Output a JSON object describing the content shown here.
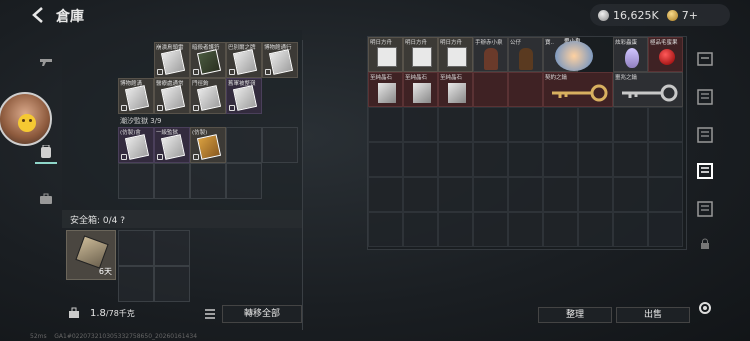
{
  "header": {
    "title": "倉庫",
    "silver": "16,625K",
    "gold": "7+"
  },
  "stash": {
    "row1": [
      "崩潰鳥頭雷",
      "暗殺者護符",
      "巴別爾之牌",
      "博物館通行"
    ],
    "row2": [
      "博物館溝",
      "醫療處通常",
      "門徑鉤",
      "舊軍被整嶺"
    ],
    "prison_label": "潮汐監獄 3/9",
    "row3": [
      "(仿製)會",
      "一級監獄",
      "(仿製)"
    ]
  },
  "safe_box": {
    "label": "安全箱: 0/4 ?",
    "days": "6天"
  },
  "weight": {
    "current": "1.8",
    "max": "/78千克"
  },
  "buttons": {
    "transfer_all": "轉移全部",
    "sort": "整理",
    "sell": "出售"
  },
  "right_grid": {
    "row1": [
      "明日方舟",
      "明日方舟",
      "明日方舟",
      "手辦赤小泉",
      "公仔",
      "寶..",
      "愛小泉",
      "炫彩蟲蛋",
      "極品毛蜜果"
    ],
    "row2": [
      "至純晶石",
      "至純晶石",
      "至純晶石",
      "契約之鑰",
      "噩兆之鑰"
    ]
  },
  "status": {
    "ping": "52ms",
    "uid": "GA1#02207321030533275865​0_20260161434"
  }
}
